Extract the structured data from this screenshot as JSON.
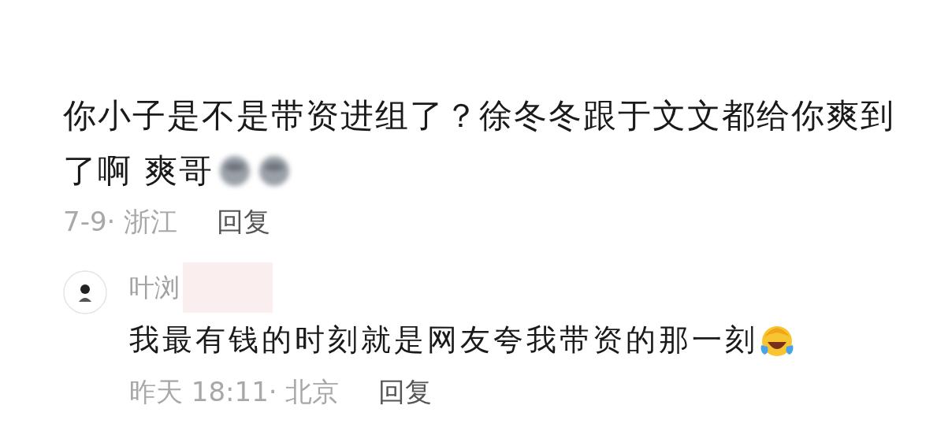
{
  "comment": {
    "text_lines": [
      "你小子是不是带资进组了？徐冬冬跟于文文都给你爽到",
      "了啊 爽哥"
    ],
    "meta": "7-9· 浙江",
    "reply_action": "回复"
  },
  "reply": {
    "author": "叶浏",
    "text": "我最有钱的时刻就是网友夸我带资的那一刻",
    "meta": "昨天 18:11· 北京",
    "reply_action": "回复"
  }
}
